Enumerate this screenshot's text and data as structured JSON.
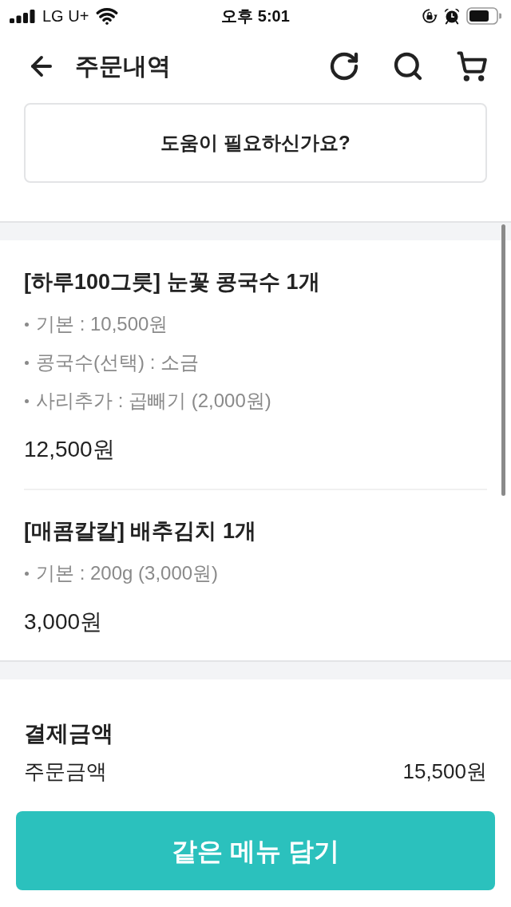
{
  "status_bar": {
    "carrier": "LG U+",
    "time": "오후 5:01"
  },
  "header": {
    "title": "주문내역"
  },
  "help_button": {
    "label": "도움이 필요하신가요?"
  },
  "order_items": [
    {
      "title": "[하루100그릇] 눈꽃 콩국수 1개",
      "options": [
        "기본 : 10,500원",
        "콩국수(선택) : 소금",
        "사리추가 : 곱빼기 (2,000원)"
      ],
      "price": "12,500원"
    },
    {
      "title": "[매콤칼칼] 배추김치 1개",
      "options": [
        "기본 : 200g (3,000원)"
      ],
      "price": "3,000원"
    }
  ],
  "payment": {
    "title": "결제금액",
    "rows": [
      {
        "label": "주문금액",
        "value": "15,500원"
      }
    ]
  },
  "primary_button": {
    "label": "같은 메뉴 담기"
  }
}
